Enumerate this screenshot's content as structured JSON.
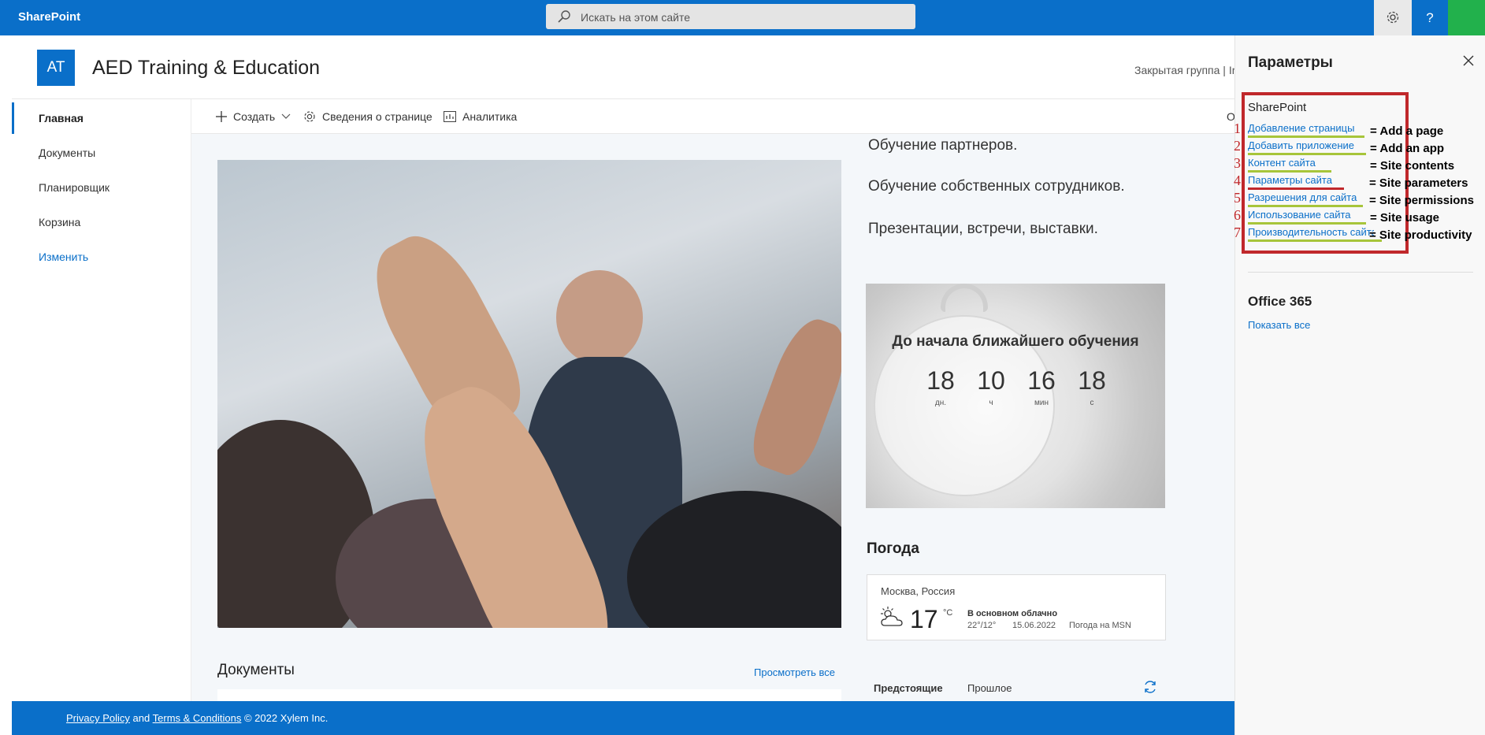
{
  "suitebar": {
    "brand": "SharePoint",
    "search_placeholder": "Искать на этом сайте",
    "help_label": "?"
  },
  "site": {
    "logo_text": "AT",
    "title": "AED Training & Education",
    "meta": "Закрытая группа | Ir"
  },
  "nav": {
    "items": [
      {
        "label": "Главная"
      },
      {
        "label": "Документы"
      },
      {
        "label": "Планировщик"
      },
      {
        "label": "Корзина"
      },
      {
        "label": "Изменить"
      }
    ]
  },
  "commandbar": {
    "create": "Создать",
    "page_details": "Сведения о странице",
    "analytics": "Аналитика",
    "overflow": "О"
  },
  "content": {
    "lines": [
      "Обучение партнеров.",
      "Обучение собственных сотрудников.",
      "Презентации, встречи, выставки."
    ],
    "countdown": {
      "title": "До начала ближайшего обучения",
      "units": [
        {
          "value": "18",
          "label": "дн."
        },
        {
          "value": "10",
          "label": "ч"
        },
        {
          "value": "16",
          "label": "мин"
        },
        {
          "value": "18",
          "label": "с"
        }
      ]
    },
    "weather": {
      "title": "Погода",
      "city": "Москва, Россия",
      "temp": "17",
      "unit": "°C",
      "description": "В основном облачно",
      "range": "22°/12°",
      "date": "15.06.2022",
      "source": "Погода на MSN"
    },
    "documents": {
      "title": "Документы",
      "view_all": "Просмотреть все"
    },
    "events": {
      "tab_upcoming": "Предстоящие",
      "tab_past": "Прошлое"
    }
  },
  "footer": {
    "privacy": "Privacy Policy",
    "and": "and",
    "terms": "Terms & Conditions",
    "copyright": "© 2022 Xylem Inc."
  },
  "panel": {
    "title": "Параметры",
    "sharepoint_head": "SharePoint",
    "links": [
      {
        "num": "1",
        "label": "Добавление страницы",
        "english": "= Add a page"
      },
      {
        "num": "2",
        "label": "Добавить приложение",
        "english": "= Add an app"
      },
      {
        "num": "3",
        "label": "Контент сайта",
        "english": "= Site contents"
      },
      {
        "num": "4",
        "label": "Параметры сайта",
        "english": "= Site parameters"
      },
      {
        "num": "5",
        "label": "Разрешения для сайта",
        "english": "= Site permissions"
      },
      {
        "num": "6",
        "label": "Использование сайта",
        "english": "= Site usage"
      },
      {
        "num": "7",
        "label": "Производительность сайта",
        "english": "= Site productivity"
      }
    ],
    "office_head": "Office 365",
    "show_all": "Показать все"
  }
}
